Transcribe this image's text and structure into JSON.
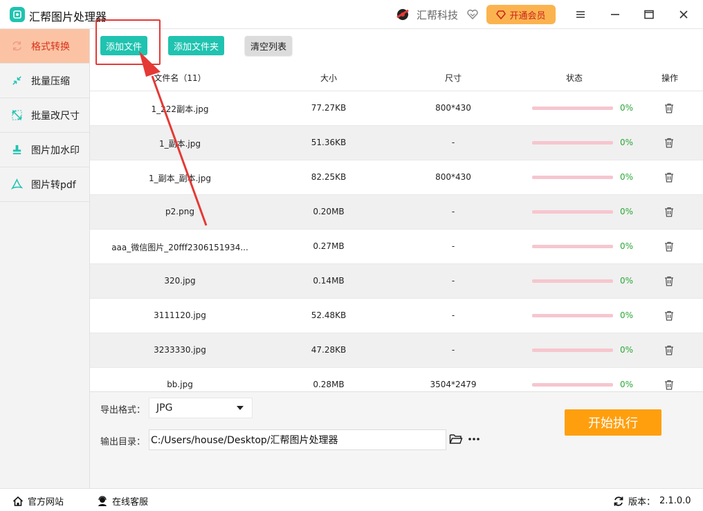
{
  "app": {
    "title": "汇帮图片处理器"
  },
  "header": {
    "brand_name": "汇帮科技",
    "vip_label": "开通会员"
  },
  "sidebar": {
    "items": [
      {
        "label": "格式转换",
        "icon": "refresh-icon",
        "active": true
      },
      {
        "label": "批量压缩",
        "icon": "compress-icon"
      },
      {
        "label": "批量改尺寸",
        "icon": "resize-icon"
      },
      {
        "label": "图片加水印",
        "icon": "stamp-icon"
      },
      {
        "label": "图片转pdf",
        "icon": "pdf-icon"
      }
    ]
  },
  "toolbar": {
    "add_file": "添加文件",
    "add_folder": "添加文件夹",
    "clear_list": "清空列表"
  },
  "table": {
    "headers": {
      "name": "文件名（11）",
      "size": "大小",
      "dim": "尺寸",
      "status": "状态",
      "ops": "操作"
    },
    "rows": [
      {
        "name": "1_222副本.jpg",
        "size": "77.27KB",
        "dim": "800*430",
        "progress": "0%"
      },
      {
        "name": "1_副本.jpg",
        "size": "51.36KB",
        "dim": "-",
        "progress": "0%"
      },
      {
        "name": "1_副本_副本.jpg",
        "size": "82.25KB",
        "dim": "800*430",
        "progress": "0%"
      },
      {
        "name": "p2.png",
        "size": "0.20MB",
        "dim": "-",
        "progress": "0%"
      },
      {
        "name": "aaa_微信图片_20fff2306151934...",
        "size": "0.27MB",
        "dim": "-",
        "progress": "0%"
      },
      {
        "name": "320.jpg",
        "size": "0.14MB",
        "dim": "-",
        "progress": "0%"
      },
      {
        "name": "3111120.jpg",
        "size": "52.48KB",
        "dim": "-",
        "progress": "0%"
      },
      {
        "name": "3233330.jpg",
        "size": "47.28KB",
        "dim": "-",
        "progress": "0%"
      },
      {
        "name": "bb.jpg",
        "size": "0.28MB",
        "dim": "3504*2479",
        "progress": "0%"
      }
    ]
  },
  "bottom": {
    "format_label": "导出格式：",
    "format_value": "JPG",
    "dir_label": "输出目录：",
    "dir_value": "C:/Users/house/Desktop/汇帮图片处理器",
    "start_label": "开始执行"
  },
  "statusbar": {
    "website": "官方网站",
    "service": "在线客服",
    "version_label": "版本：",
    "version": "2.1.0.0"
  },
  "colors": {
    "accent": "#1fc3b0",
    "active_nav_bg": "#fbc3a4",
    "active_nav_text": "#d9331c",
    "start_button": "#ff9f0e",
    "vip_button": "#fbb34f",
    "progress_text": "#2aa836",
    "annotation_red": "#e53935"
  }
}
